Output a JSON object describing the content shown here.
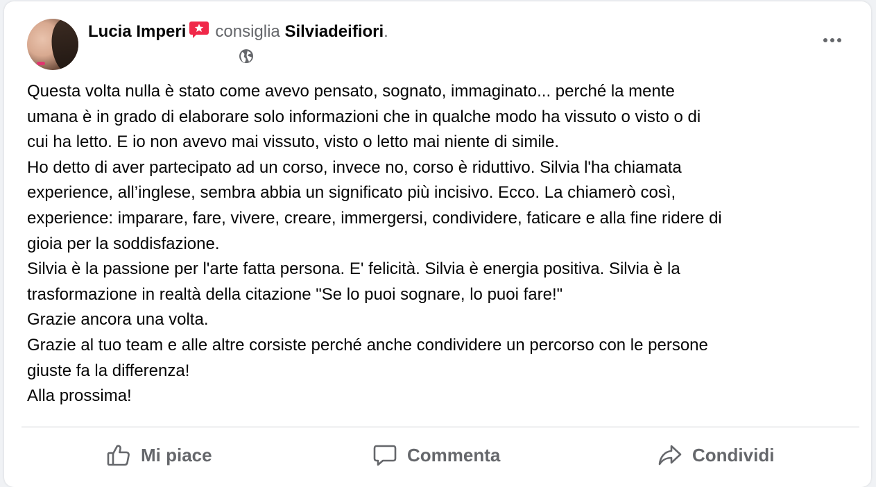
{
  "post": {
    "author": "Lucia Imperi",
    "action_text": "consiglia",
    "page_name": "Silviadeifiori",
    "period": ".",
    "visibility_icon": "globe-icon",
    "menu_icon": "more-horizontal-icon",
    "body_lines": [
      "Questa volta nulla è stato come avevo pensato, sognato, immaginato... perché la mente",
      "umana è in grado di elaborare solo informazioni che in qualche modo ha vissuto o visto o di",
      "cui ha letto. E io non avevo mai vissuto, visto o letto mai niente di simile.",
      "Ho detto di aver partecipato ad un corso, invece no, corso è riduttivo. Silvia l'ha chiamata",
      "experience, all’inglese, sembra abbia un significato più incisivo. Ecco. La chiamerò così,",
      "experience: imparare, fare, vivere, creare, immergersi, condividere, faticare e alla fine ridere di",
      "gioia per la soddisfazione.",
      "Silvia è la passione per l'arte fatta persona. E' felicità. Silvia è energia positiva. Silvia è la",
      "trasformazione in realtà della citazione \"Se lo puoi sognare, lo puoi fare!\"",
      "Grazie ancora una volta.",
      "Grazie al tuo team e alle altre corsiste perché anche condividere un percorso con le persone",
      "giuste fa la differenza!",
      "Alla prossima!"
    ]
  },
  "actions": {
    "like_label": "Mi piace",
    "comment_label": "Commenta",
    "share_label": "Condividi"
  },
  "colors": {
    "text_primary": "#050505",
    "text_secondary": "#65676b",
    "badge_red": "#f02849",
    "divider": "#ced0d4"
  }
}
